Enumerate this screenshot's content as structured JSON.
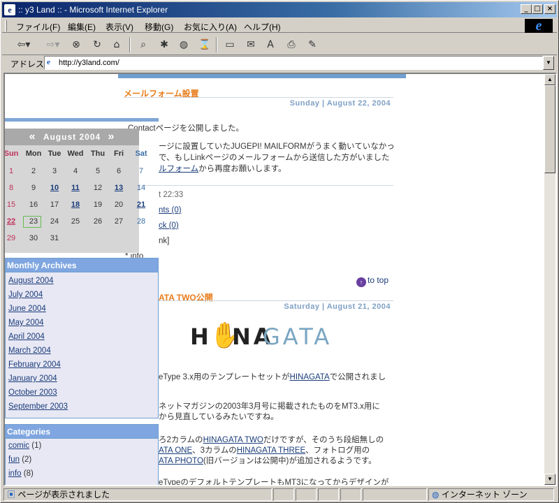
{
  "window": {
    "title": ":: y3 Land :: - Microsoft Internet Explorer"
  },
  "menu": [
    "ファイル(F)",
    "編集(E)",
    "表示(V)",
    "移動(G)",
    "お気に入り(A)",
    "ヘルプ(H)"
  ],
  "address": {
    "label": "アドレス",
    "url": "http://y3land.com/"
  },
  "post1": {
    "title": "メールフォーム設置",
    "date": "Sunday | August 22, 2004",
    "p1": "Contactページを公開しました。",
    "p2a": "ージに設置していたJUGEPI! MAILFORMがうまく動いていなかっ",
    "p2b": "で、もしLinkページのメールフォームから送信した方がいました",
    "p2c_link": "ルフォーム",
    "p2c": "から再度お願いします。",
    "posted": "t 22:33",
    "comments": "nts (0)",
    "trackback": "ck (0)",
    "permalink": "nk]",
    "category": "* info"
  },
  "to_top": "to top",
  "post2": {
    "title": "ATA TWO公開",
    "date": "Saturday | August 21, 2004",
    "logo_a": "H",
    "logo_b": "NA",
    "logo_c": "GATA",
    "l1a": "eType 3.x用のテンプレートセットが",
    "l1_link": "HINAGATA",
    "l1b": "で公開されまし",
    "l2a": "ネットマガジンの2003年3月号に掲載されたものをMT3.x用に",
    "l2b": "から見直しているみたいですね。",
    "l3a": "ろ2カラムの",
    "l3_link1": "HINAGATA TWO",
    "l3b": "だけですが、そのうち段組無しの",
    "l4_link1": "ATA ONE",
    "l4a": "、3カラムの",
    "l4_link2": "HINAGATA THREE",
    "l4b": "、フォトログ用の",
    "l5_link": "ATA PHOTO",
    "l5a": "(旧バージョンは公開中)が追加されるようです。",
    "l6": "eTypeのデフォルトテンプレートもMT3になってからデザインが"
  },
  "calendar": {
    "title": "August 2004",
    "prev": "«",
    "next": "»",
    "days": [
      "Sun",
      "Mon",
      "Tue",
      "Wed",
      "Thu",
      "Fri",
      "Sat"
    ],
    "weeks": [
      [
        "1",
        "2",
        "3",
        "4",
        "5",
        "6",
        "7"
      ],
      [
        "8",
        "9",
        "10",
        "11",
        "12",
        "13",
        "14"
      ],
      [
        "15",
        "16",
        "17",
        "18",
        "19",
        "20",
        "21"
      ],
      [
        "22",
        "23",
        "24",
        "25",
        "26",
        "27",
        "28"
      ],
      [
        "29",
        "30",
        "31",
        "",
        "",
        "",
        ""
      ]
    ],
    "linked": [
      "10",
      "11",
      "13",
      "18",
      "21",
      "22"
    ],
    "today": "23"
  },
  "archives": {
    "title": "Monthly Archives",
    "items": [
      "August 2004",
      "July 2004",
      "June 2004",
      "May 2004",
      "April 2004",
      "March 2004",
      "February 2004",
      "January 2004",
      "October 2003",
      "September 2003"
    ]
  },
  "categories": {
    "title": "Categories",
    "items": [
      {
        "name": "comic",
        "count": "(1)"
      },
      {
        "name": "fun",
        "count": "(2)"
      },
      {
        "name": "info",
        "count": "(8)"
      }
    ]
  },
  "status": {
    "text": "ページが表示されました",
    "zone": "インターネット ゾーン"
  }
}
